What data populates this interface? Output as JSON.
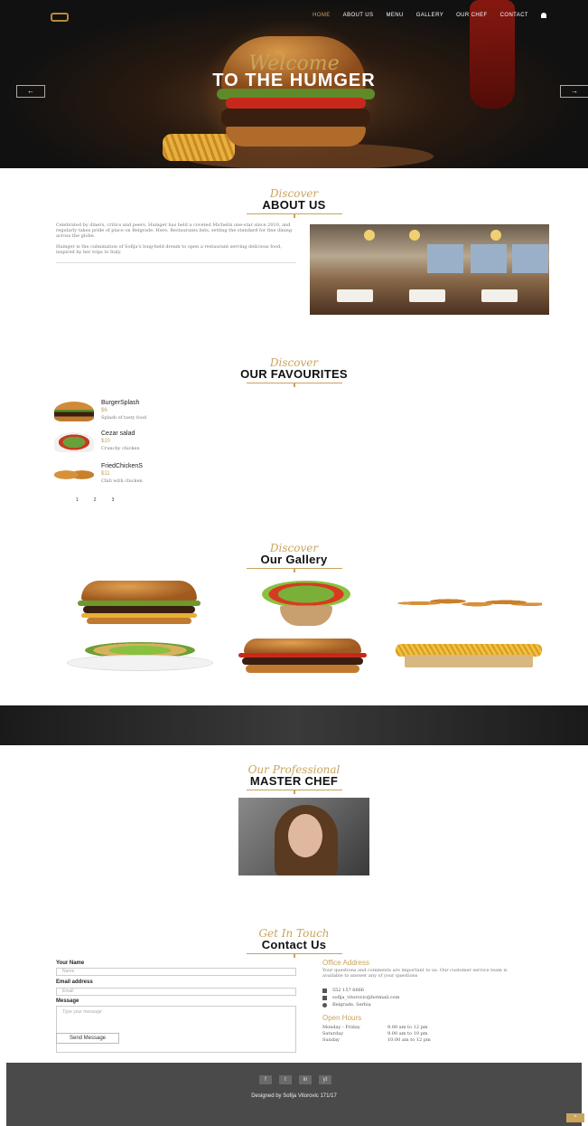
{
  "nav": {
    "items": [
      "HOME",
      "ABOUT US",
      "MENU",
      "GALLERY",
      "OUR CHEF",
      "CONTACT"
    ]
  },
  "hero": {
    "script": "Welcome",
    "title": "TO THE HUMGER",
    "prev_label": "←",
    "next_label": "→"
  },
  "about": {
    "script": "Discover",
    "title": "ABOUT US",
    "paragraphs": [
      "Celebrated by diners, critics and peers, Humger has held a coveted Michelin one-star since 2010, and regularly takes pride of place on Belgrade. Here, Restaurants lists, setting the standard for fine dining across the globe.",
      "Humger is the culmination of Sofija’s long-held dream to open a restaurant serving delicious food, inspired by her trips to Italy."
    ]
  },
  "favourites": {
    "script": "Discover",
    "title": "OUR FAVOURITES",
    "items": [
      {
        "name": "BurgerSplash",
        "price": "$6",
        "desc": "Splash of tasty food"
      },
      {
        "name": "Cezar salad",
        "price": "$10",
        "desc": "Crunchy chicken"
      },
      {
        "name": "FriedChickenS",
        "price": "$11",
        "desc": "Chili with chicken"
      }
    ],
    "pages": [
      "1",
      "2",
      "3"
    ]
  },
  "gallery": {
    "script": "Discover",
    "title": "Our Gallery"
  },
  "chef": {
    "script": "Our Professional",
    "title": "MASTER CHEF"
  },
  "contact": {
    "script": "Get In Touch",
    "title": "Contact Us",
    "name_label": "Your Name",
    "name_placeholder": "Name",
    "email_label": "Email address",
    "email_placeholder": "Email",
    "message_label": "Message",
    "message_placeholder": "Type your message",
    "send_label": "Send Message",
    "office_title": "Office Address",
    "office_text": "Your questions and comments are important to us. Our customer service team is available to answer any of your questions",
    "phone": "552 157 6666",
    "email": "sofija_vitorovic@hotmail.com",
    "address": "Belgrade, Serbia",
    "hours_title": "Open Hours",
    "hours": [
      {
        "day": "Monday - Friday",
        "time": "9.00 am to 12 pm"
      },
      {
        "day": "Saturday",
        "time": "9.00 am to 10 pm"
      },
      {
        "day": "Sunday",
        "time": "10.00 am to 12 pm"
      }
    ]
  },
  "footer": {
    "social": [
      "f",
      "t",
      "in",
      "yt"
    ],
    "credit": "Designed by Sofija Vitorovic 171/17",
    "top_label": "^"
  },
  "colors": {
    "accent": "#c9a45c",
    "footer_bg": "#4a4a4a"
  }
}
